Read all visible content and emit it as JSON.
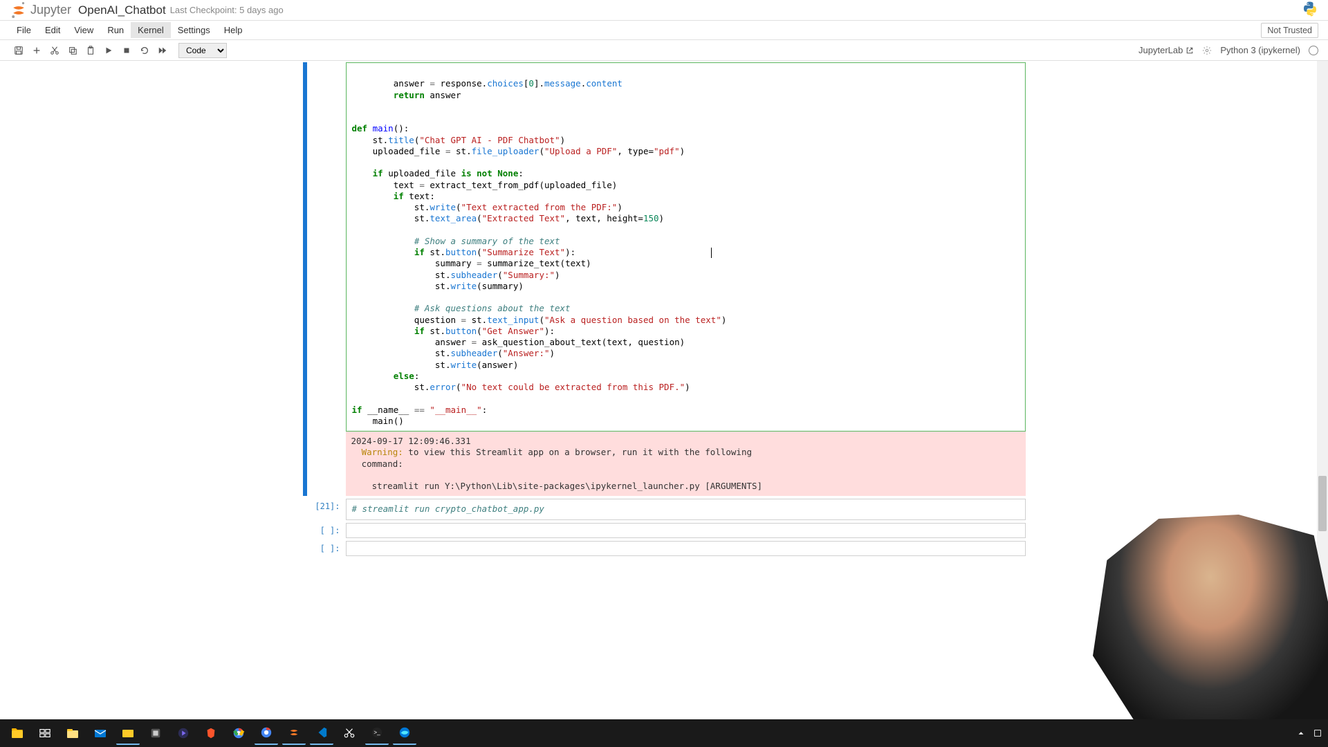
{
  "header": {
    "logo_text": "Jupyter",
    "notebook_name": "OpenAI_Chatbot",
    "checkpoint": "Last Checkpoint: 5 days ago"
  },
  "menu": {
    "items": [
      "File",
      "Edit",
      "View",
      "Run",
      "Kernel",
      "Settings",
      "Help"
    ],
    "not_trusted": "Not Trusted"
  },
  "toolbar": {
    "cell_type": "Code",
    "jupyterlab": "JupyterLab",
    "kernel": "Python 3 (ipykernel)"
  },
  "cells": {
    "output_timestamp": "2024-09-17 12:09:46.331",
    "output_warn_label": "Warning:",
    "output_warn_text": " to view this Streamlit app on a browser, run it with the following\n  command:",
    "output_cmd": "    streamlit run Y:\\Python\\Lib\\site-packages\\ipykernel_launcher.py [ARGUMENTS]",
    "cell21_prompt": "[21]:",
    "cell21_code": "# streamlit run crypto_chatbot_app.py",
    "empty_prompt": "[ ]:"
  },
  "code": {
    "l1a": "        answer ",
    "l1b": "=",
    "l1c": " response.",
    "l1d": "choices",
    "l1e": "[",
    "l1f": "0",
    "l1g": "].",
    "l1h": "message",
    "l1i": ".",
    "l1j": "content",
    "l2a": "        ",
    "l2b": "return",
    "l2c": " answer",
    "l3a": "def",
    "l3b": " ",
    "l3c": "main",
    "l3d": "():",
    "l4a": "    st.",
    "l4b": "title",
    "l4c": "(",
    "l4d": "\"Chat GPT AI - PDF Chatbot\"",
    "l4e": ")",
    "l5a": "    uploaded_file ",
    "l5b": "=",
    "l5c": " st.",
    "l5d": "file_uploader",
    "l5e": "(",
    "l5f": "\"Upload a PDF\"",
    "l5g": ", type=",
    "l5h": "\"pdf\"",
    "l5i": ")",
    "l6a": "    ",
    "l6b": "if",
    "l6c": " uploaded_file ",
    "l6d": "is not",
    "l6e": " ",
    "l6f": "None",
    "l6g": ":",
    "l7a": "        text ",
    "l7b": "=",
    "l7c": " extract_text_from_pdf(uploaded_file)",
    "l8a": "        ",
    "l8b": "if",
    "l8c": " text:",
    "l9a": "            st.",
    "l9b": "write",
    "l9c": "(",
    "l9d": "\"Text extracted from the PDF:\"",
    "l9e": ")",
    "l10a": "            st.",
    "l10b": "text_area",
    "l10c": "(",
    "l10d": "\"Extracted Text\"",
    "l10e": ", text, height=",
    "l10f": "150",
    "l10g": ")",
    "l11a": "            ",
    "l11b": "# Show a summary of the text",
    "l12a": "            ",
    "l12b": "if",
    "l12c": " st.",
    "l12d": "button",
    "l12e": "(",
    "l12f": "\"Summarize Text\"",
    "l12g": "):",
    "l13a": "                summary ",
    "l13b": "=",
    "l13c": " summarize_text(text)",
    "l14a": "                st.",
    "l14b": "subheader",
    "l14c": "(",
    "l14d": "\"Summary:\"",
    "l14e": ")",
    "l15a": "                st.",
    "l15b": "write",
    "l15c": "(summary)",
    "l16a": "            ",
    "l16b": "# Ask questions about the text",
    "l17a": "            question ",
    "l17b": "=",
    "l17c": " st.",
    "l17d": "text_input",
    "l17e": "(",
    "l17f": "\"Ask a question based on the text\"",
    "l17g": ")",
    "l18a": "            ",
    "l18b": "if",
    "l18c": " st.",
    "l18d": "button",
    "l18e": "(",
    "l18f": "\"Get Answer\"",
    "l18g": "):",
    "l19a": "                answer ",
    "l19b": "=",
    "l19c": " ask_question_about_text(text, question)",
    "l20a": "                st.",
    "l20b": "subheader",
    "l20c": "(",
    "l20d": "\"Answer:\"",
    "l20e": ")",
    "l21a": "                st.",
    "l21b": "write",
    "l21c": "(answer)",
    "l22a": "        ",
    "l22b": "else",
    "l22c": ":",
    "l23a": "            st.",
    "l23b": "error",
    "l23c": "(",
    "l23d": "\"No text could be extracted from this PDF.\"",
    "l23e": ")",
    "l24a": "if",
    "l24b": " __name__ ",
    "l24c": "==",
    "l24d": " ",
    "l24e": "\"__main__\"",
    "l24f": ":",
    "l25a": "    main()"
  }
}
